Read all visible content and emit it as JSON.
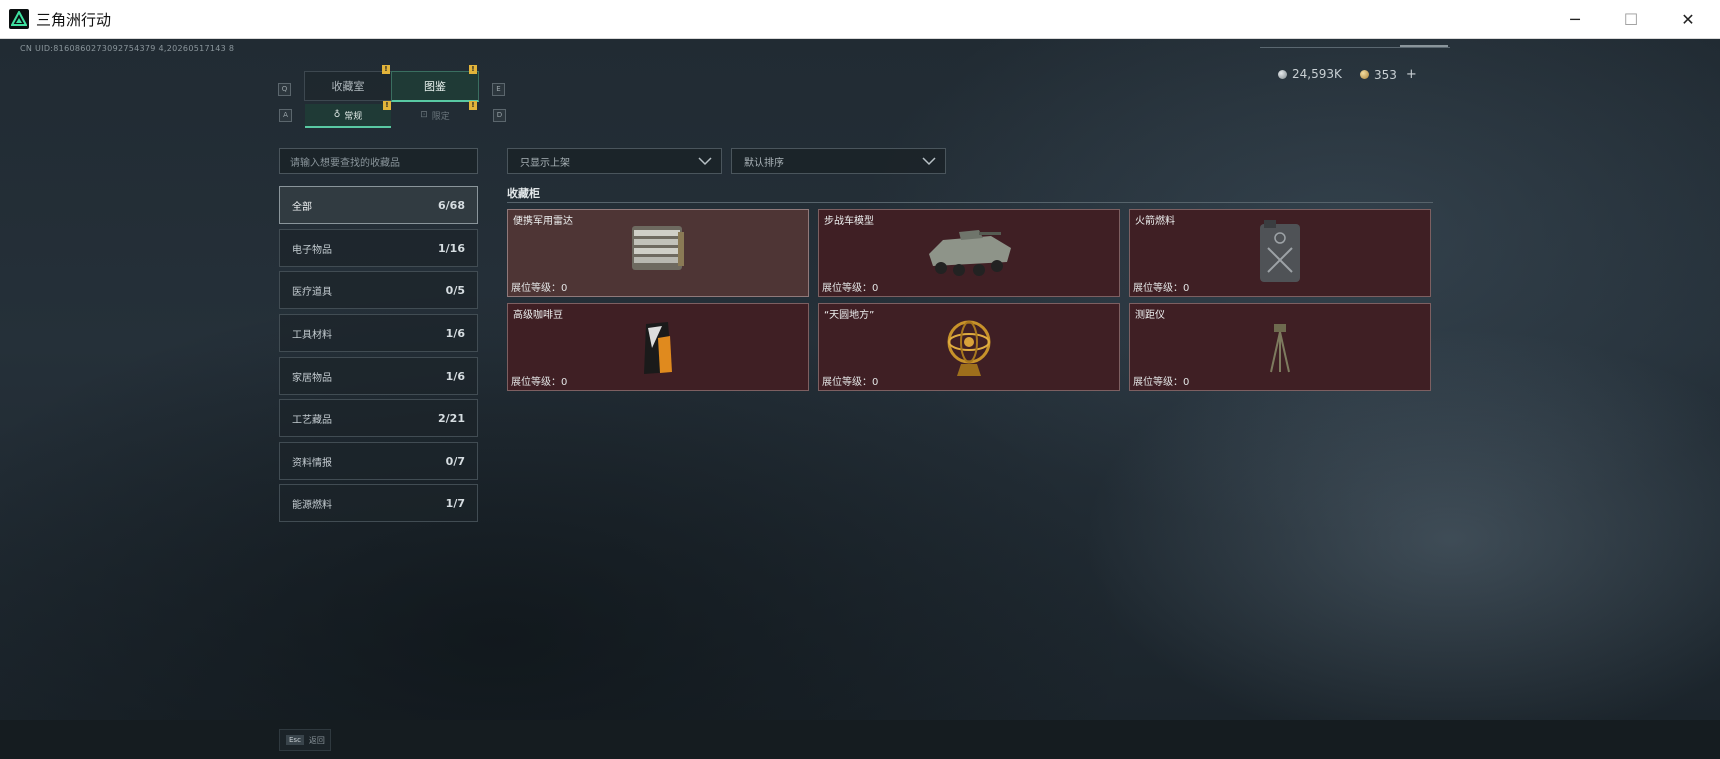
{
  "window": {
    "title": "三角洲行动",
    "minimize": "─",
    "maximize": "☐",
    "close": "✕"
  },
  "header": {
    "uid": "CN UID:8160860273092754379 4,20260517143 8",
    "currency_1": "24,593K",
    "currency_2": "353",
    "add_symbol": "+"
  },
  "tabs": {
    "key_left": "Q",
    "key_right": "E",
    "collection_room": "收藏室",
    "catalog": "图鉴",
    "badge": "!"
  },
  "subtabs": {
    "key_left": "A",
    "key_right": "D",
    "regular": "常规",
    "limited": "限定"
  },
  "search": {
    "placeholder": "请输入想要查找的收藏品"
  },
  "filters": {
    "show": "只显示上架",
    "sort": "默认排序"
  },
  "categories": [
    {
      "label": "全部",
      "count": "6/68"
    },
    {
      "label": "电子物品",
      "count": "1/16"
    },
    {
      "label": "医疗道具",
      "count": "0/5"
    },
    {
      "label": "工具材料",
      "count": "1/6"
    },
    {
      "label": "家居物品",
      "count": "1/6"
    },
    {
      "label": "工艺藏品",
      "count": "2/21"
    },
    {
      "label": "资料情报",
      "count": "0/7"
    },
    {
      "label": "能源燃料",
      "count": "1/7"
    }
  ],
  "section": {
    "title": "收藏柜"
  },
  "items": [
    {
      "name": "便携军用雷达",
      "level": "展位等级：0",
      "icon": "radar-icon"
    },
    {
      "name": "步战车模型",
      "level": "展位等级：0",
      "icon": "ifv-model-icon"
    },
    {
      "name": "火箭燃料",
      "level": "展位等级：0",
      "icon": "fuel-canister-icon"
    },
    {
      "name": "高级咖啡豆",
      "level": "展位等级：0",
      "icon": "coffee-bag-icon"
    },
    {
      "name": "“天圆地方”",
      "level": "展位等级：0",
      "icon": "armillary-sphere-icon"
    },
    {
      "name": "测距仪",
      "level": "展位等级：0",
      "icon": "rangefinder-icon"
    }
  ],
  "footer": {
    "esc_key": "Esc",
    "back": "返回"
  }
}
